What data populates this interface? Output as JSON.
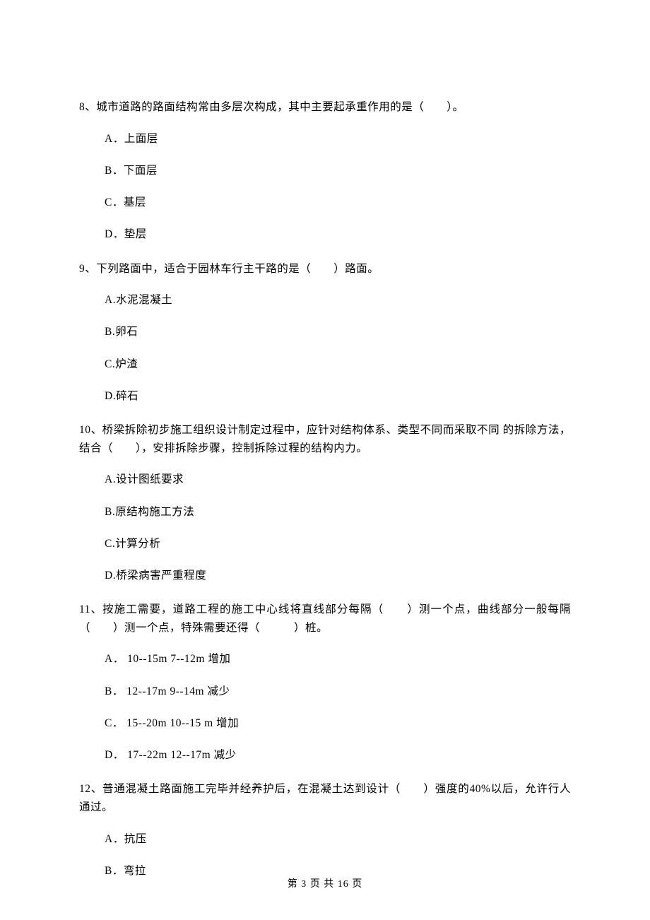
{
  "questions": [
    {
      "stem": "8、城市道路的路面结构常由多层次构成，其中主要起承重作用的是（　　）。",
      "options": [
        "A．上面层",
        "B．下面层",
        "C．基层",
        "D．垫层"
      ]
    },
    {
      "stem": "9、下列路面中，适合于园林车行主干路的是（　　）路面。",
      "options": [
        "A.水泥混凝土",
        "B.卵石",
        "C.炉渣",
        "D.碎石"
      ]
    },
    {
      "stem": "10、桥梁拆除初步施工组织设计制定过程中，应针对结构体系、类型不同而采取不同 的拆除方法，结合（　　），安排拆除步骤，控制拆除过程的结构内力。",
      "options": [
        "A.设计图纸要求",
        "B.原结构施工方法",
        "C.计算分析",
        "D.桥梁病害严重程度"
      ]
    },
    {
      "stem": "11、按施工需要，道路工程的施工中心线将直线部分每隔（　　）测一个点，曲线部分一般每隔 （　　）测一个点，特殊需要还得（　　　）桩。",
      "options": [
        "A． 10--15m 7--12m 增加",
        "B． 12--17m 9--14m 减少",
        "C． 15--20m 10--15 m 增加",
        "D． 17--22m 12--17m 减少"
      ]
    },
    {
      "stem": "12、普通混凝土路面施工完毕并经养护后，在混凝土达到设计（　　）强度的40%以后，允许行人通过。",
      "options": [
        "A．抗压",
        "B．弯拉"
      ]
    }
  ],
  "footer": "第 3 页 共 16 页"
}
